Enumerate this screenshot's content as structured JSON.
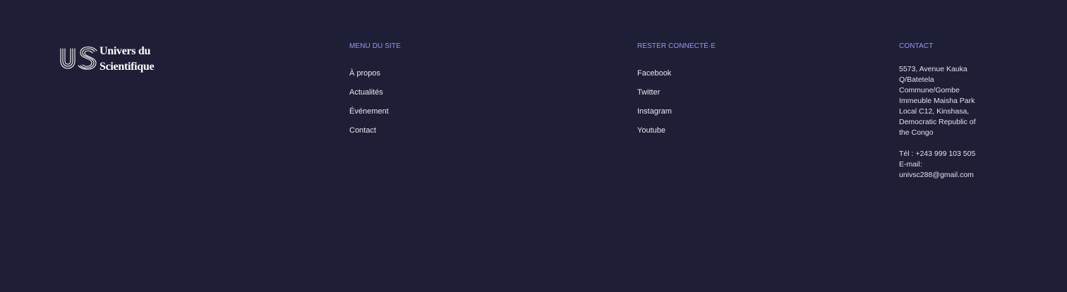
{
  "brand": {
    "line1": "Univers du",
    "line2": "Scientifique",
    "logo_icon": "us-monogram-icon"
  },
  "menu": {
    "heading": "MENU DU SITE",
    "items": [
      {
        "label": "À propos"
      },
      {
        "label": "Actualités"
      },
      {
        "label": "Événement"
      },
      {
        "label": "Contact"
      }
    ]
  },
  "social": {
    "heading": "RESTER CONNECTÉ·E",
    "items": [
      {
        "label": "Facebook"
      },
      {
        "label": "Twitter"
      },
      {
        "label": "Instagram"
      },
      {
        "label": "Youtube"
      }
    ]
  },
  "contact": {
    "heading": "CONTACT",
    "address_lines": [
      "5573, Avenue Kauka",
      "Q/Batetela",
      "Commune/Gombe",
      "Immeuble Maisha Park",
      "Local C12, Kinshasa,",
      "Democratic Republic of",
      "the Congo"
    ],
    "phone": "Tél : +243 999 103 505",
    "email_label": "E-mail:",
    "email": "univsc288@gmail.com"
  },
  "colors": {
    "background": "#1e1e36",
    "heading_accent": "#9b97f2",
    "text": "#e8e8f2"
  }
}
